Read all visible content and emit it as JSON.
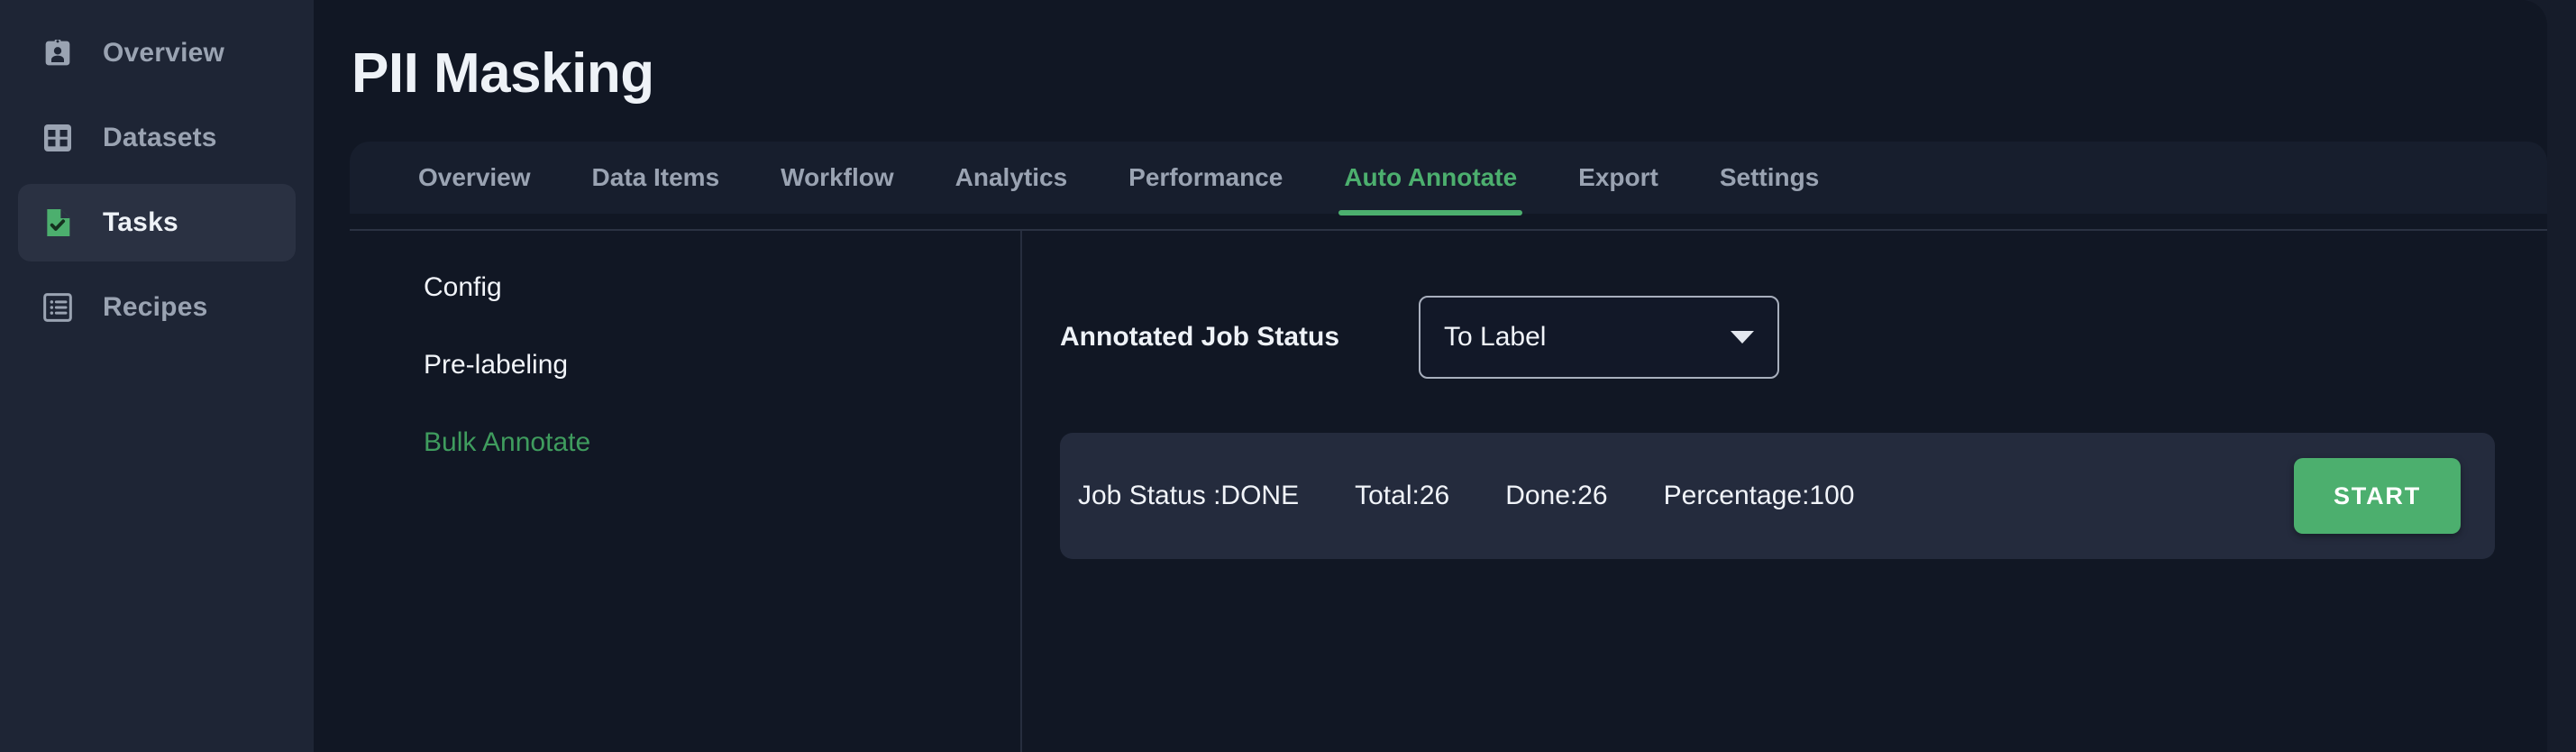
{
  "sidebar": {
    "items": [
      {
        "label": "Overview",
        "icon": "id-badge-icon",
        "active": false
      },
      {
        "label": "Datasets",
        "icon": "grid-icon",
        "active": false
      },
      {
        "label": "Tasks",
        "icon": "task-document-check-icon",
        "active": true
      },
      {
        "label": "Recipes",
        "icon": "list-icon",
        "active": false
      }
    ]
  },
  "header": {
    "title": "PII Masking"
  },
  "tabs": [
    {
      "label": "Overview",
      "active": false
    },
    {
      "label": "Data Items",
      "active": false
    },
    {
      "label": "Workflow",
      "active": false
    },
    {
      "label": "Analytics",
      "active": false
    },
    {
      "label": "Performance",
      "active": false
    },
    {
      "label": "Auto Annotate",
      "active": true
    },
    {
      "label": "Export",
      "active": false
    },
    {
      "label": "Settings",
      "active": false
    }
  ],
  "subnav": {
    "items": [
      {
        "label": "Config",
        "active": false
      },
      {
        "label": "Pre-labeling",
        "active": false
      },
      {
        "label": "Bulk Annotate",
        "active": true
      }
    ]
  },
  "pane": {
    "field_label": "Annotated Job Status",
    "select": {
      "value": "To Label",
      "caret_icon": "chevron-down-icon"
    },
    "status": {
      "job_status": "Job Status :DONE",
      "total": "Total:26",
      "done": "Done:26",
      "percentage": "Percentage:100"
    },
    "start_label": "START"
  },
  "colors": {
    "accent_green": "#4caf6e",
    "subnav_active_green": "#3f9c5e",
    "sidebar_bg": "#1e2535",
    "panel_bg": "#111724",
    "card_bg": "#242b3d",
    "page_bg": "#161c2a",
    "text_primary": "#eef2f7",
    "text_muted": "#9aa3b2"
  }
}
